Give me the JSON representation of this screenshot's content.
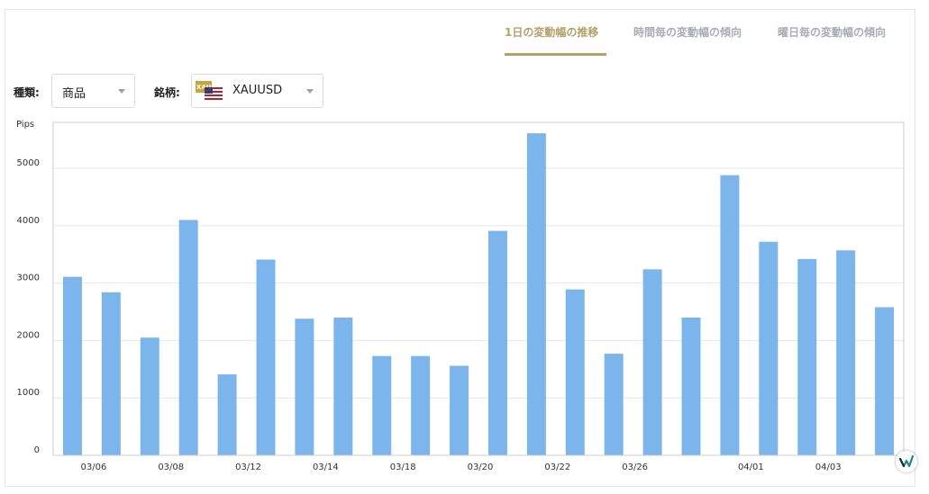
{
  "tabs": [
    {
      "label": "1日の変動幅の推移",
      "active": true
    },
    {
      "label": "時間毎の変動幅の傾向",
      "active": false
    },
    {
      "label": "曜日毎の変動幅の傾向",
      "active": false
    }
  ],
  "filters": {
    "type_label": "種類:",
    "type_value": "商品",
    "symbol_label": "銘柄:",
    "symbol_value": "XAUUSD",
    "symbol_flag_text": "XAU"
  },
  "colors": {
    "bar": "#7cb5ec",
    "accent": "#b3a06a",
    "grid": "#e6e6e6",
    "axis": "#cccccc"
  },
  "chart_data": {
    "type": "bar",
    "ylabel": "Pips",
    "ylim": [
      0,
      5800
    ],
    "yticks": [
      0,
      1000,
      2000,
      3000,
      4000,
      5000
    ],
    "grid": true,
    "values": [
      3110,
      2840,
      2050,
      4100,
      1410,
      3410,
      2380,
      2400,
      1730,
      1730,
      1560,
      3910,
      5610,
      2890,
      1770,
      3240,
      2400,
      4880,
      3720,
      3420,
      3570,
      2580
    ],
    "xtick_labels": [
      {
        "label": "03/06",
        "bar_index": 1
      },
      {
        "label": "03/08",
        "bar_index": 3
      },
      {
        "label": "03/12",
        "bar_index": 5
      },
      {
        "label": "03/14",
        "bar_index": 7
      },
      {
        "label": "03/18",
        "bar_index": 9
      },
      {
        "label": "03/20",
        "bar_index": 11
      },
      {
        "label": "03/22",
        "bar_index": 13
      },
      {
        "label": "03/26",
        "bar_index": 15
      },
      {
        "label": "04/01",
        "bar_index": 18
      },
      {
        "label": "04/03",
        "bar_index": 20
      }
    ]
  }
}
